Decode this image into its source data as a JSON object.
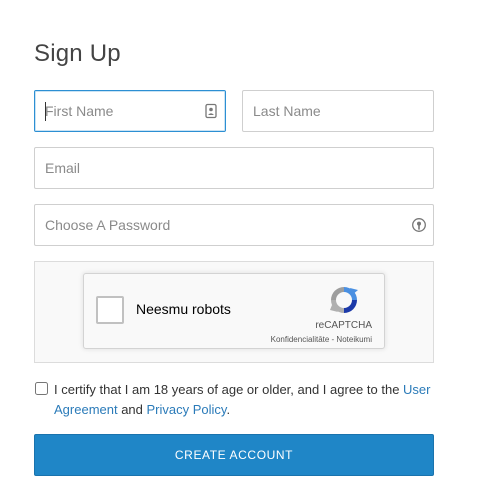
{
  "form": {
    "title": "Sign Up",
    "first_name": {
      "placeholder": "First Name",
      "value": ""
    },
    "last_name": {
      "placeholder": "Last Name",
      "value": ""
    },
    "email": {
      "placeholder": "Email",
      "value": ""
    },
    "password": {
      "placeholder": "Choose A Password",
      "value": ""
    }
  },
  "recaptcha": {
    "label": "Neesmu robots",
    "brand": "reCAPTCHA",
    "links": "Konfidencialitāte - Noteikumi"
  },
  "certify": {
    "text_before": "I certify that I am 18 years of age or older, and I agree to the ",
    "user_agreement": "User Agreement",
    "and": " and ",
    "privacy_policy": "Privacy Policy",
    "text_after": "."
  },
  "submit": {
    "label": "CREATE ACCOUNT"
  },
  "colors": {
    "accent": "#1f86c7",
    "link": "#2b7bb9",
    "focus": "#2c8fd3"
  }
}
